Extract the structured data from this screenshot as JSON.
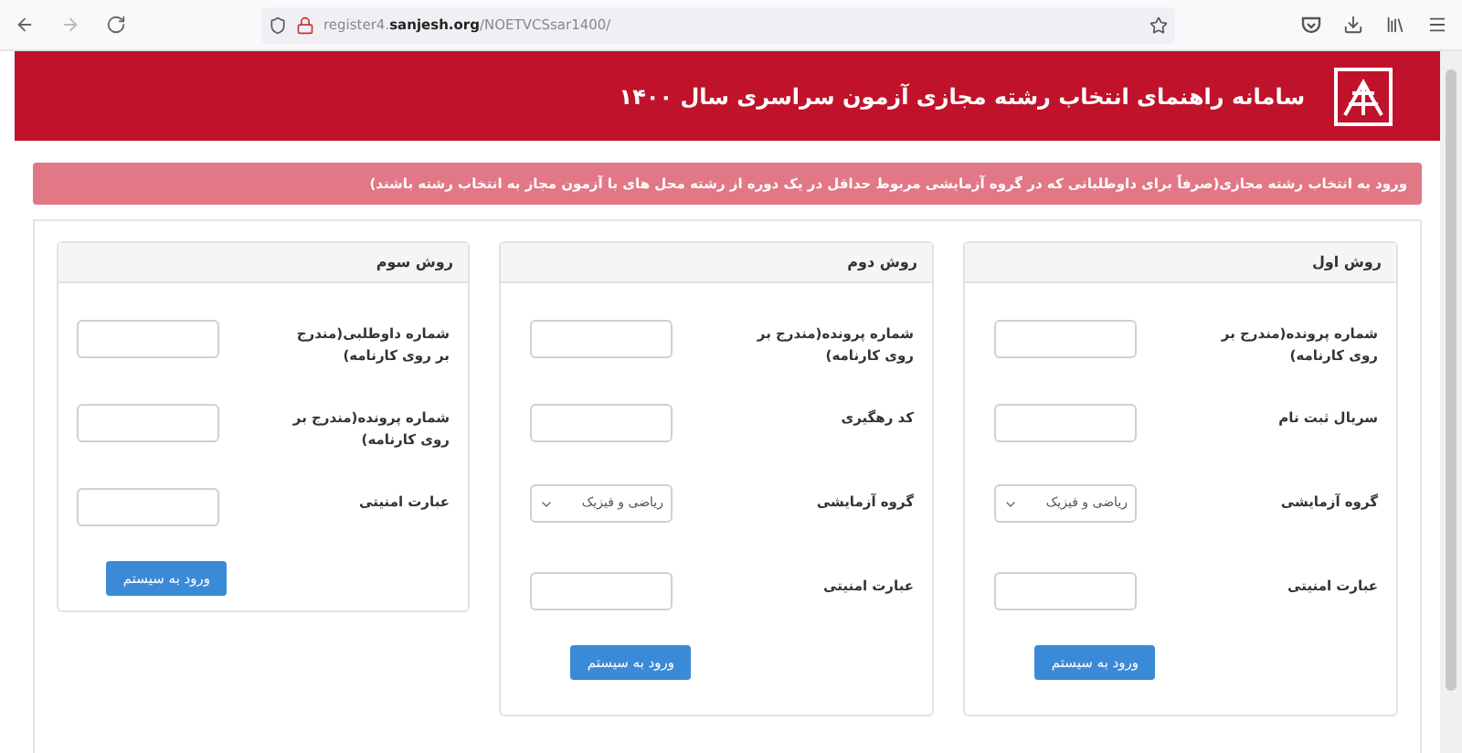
{
  "browser": {
    "url_host": "register4.",
    "url_domain": "sanjesh.org",
    "url_path": "/NOETVCSsar1400/"
  },
  "header": {
    "title": "سامانه راهنمای انتخاب رشته مجازی آزمون سراسری سال ۱۴۰۰"
  },
  "alert": {
    "text": "ورود به انتخاب رشته مجازی(صرفاً برای داوطلبانی که در گروه آزمایشی مربوط حداقل در یک دوره از رشته محل های با آزمون مجاز به انتخاب رشته باشند)"
  },
  "panels": [
    {
      "title": "روش اول",
      "fields": [
        {
          "kind": "input",
          "label": "شماره پرونده(مندرج بر روی کارنامه)"
        },
        {
          "kind": "input",
          "label": "سریال ثبت نام"
        },
        {
          "kind": "select",
          "label": "گروه آزمایشی",
          "value": "ریاضی و فیزیک"
        },
        {
          "kind": "input",
          "label": "عبارت امنیتی"
        }
      ],
      "button": "ورود به سیستم"
    },
    {
      "title": "روش دوم",
      "fields": [
        {
          "kind": "input",
          "label": "شماره پرونده(مندرج بر روی کارنامه)"
        },
        {
          "kind": "input",
          "label": "کد رهگیری"
        },
        {
          "kind": "select",
          "label": "گروه آزمایشی",
          "value": "ریاضی و فیزیک"
        },
        {
          "kind": "input",
          "label": "عبارت امنیتی"
        }
      ],
      "button": "ورود به سیستم"
    },
    {
      "title": "روش سوم",
      "fields": [
        {
          "kind": "input",
          "label": "شماره داوطلبی(مندرج بر روی کارنامه)"
        },
        {
          "kind": "input",
          "label": "شماره پرونده(مندرج بر روی کارنامه)"
        },
        {
          "kind": "input",
          "label": "عبارت امنیتی"
        }
      ],
      "button": "ورود به سیستم"
    }
  ]
}
